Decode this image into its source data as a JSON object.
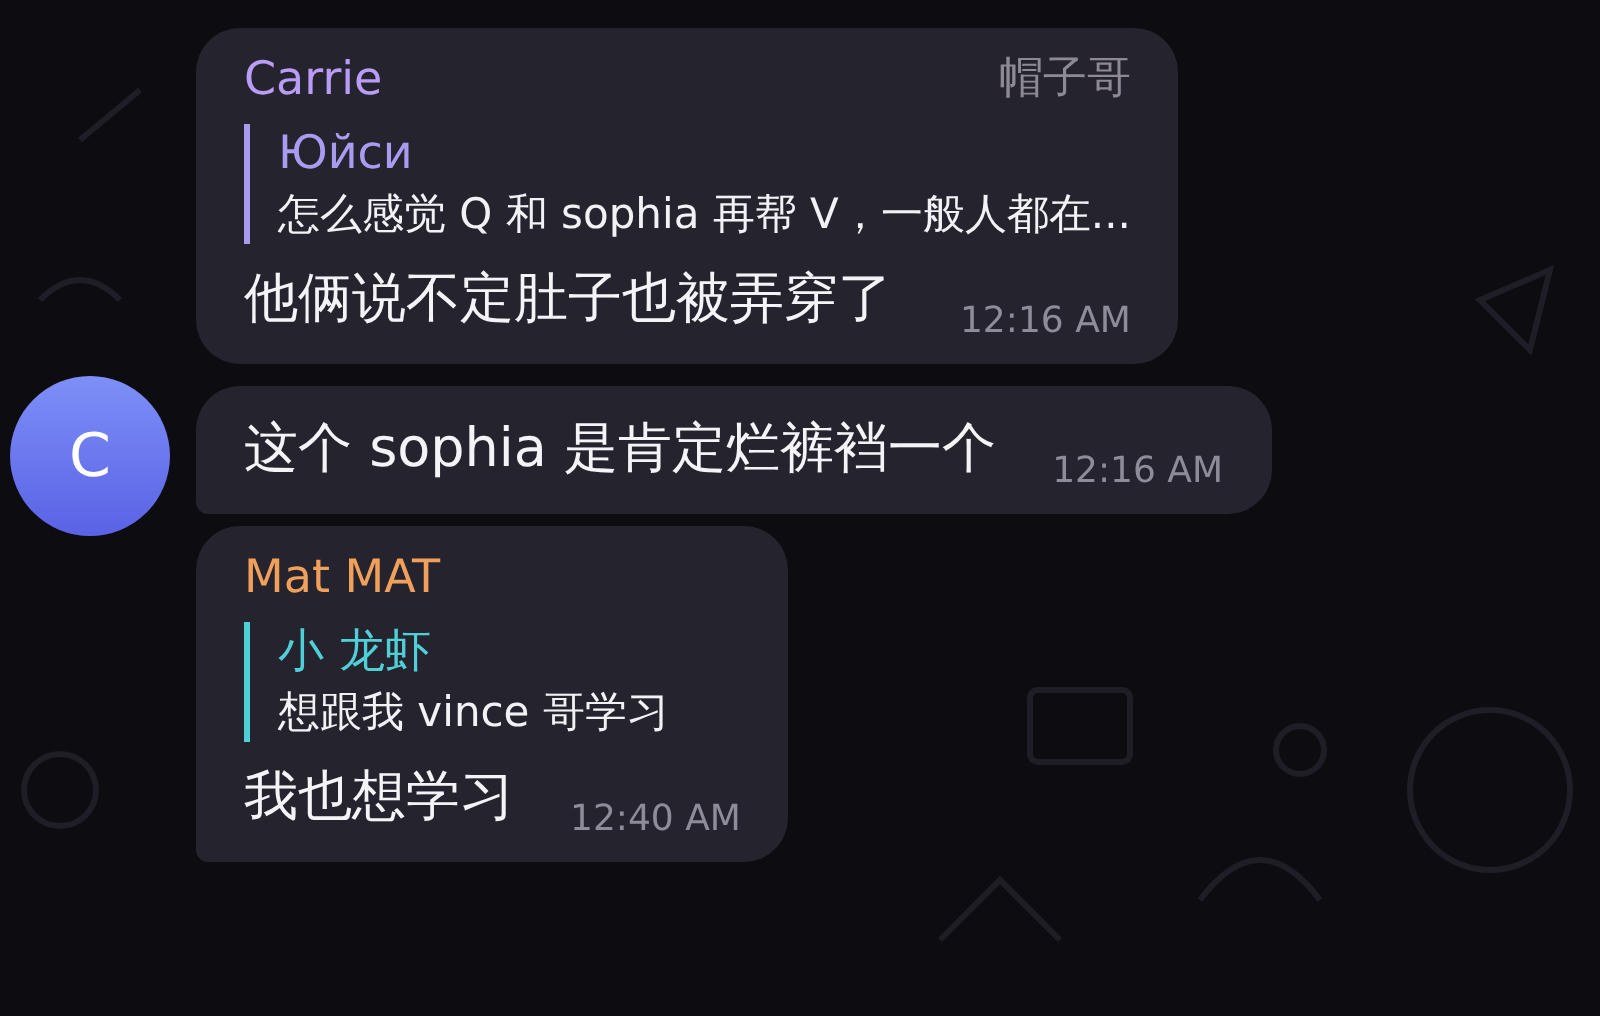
{
  "messages": [
    {
      "sender": "Carrie",
      "color": "#b99cf5",
      "title": "帽子哥",
      "reply": {
        "author": "Юйси",
        "text": "怎么感觉 Q 和 sophia 再帮 V，一般人都在...",
        "color": "#a89cf0"
      },
      "text": "他俩说不定肚子也被弄穿了",
      "time": "12:16 AM"
    },
    {
      "avatar": "C",
      "text": "这个 sophia 是肯定烂裤裆一个",
      "time": "12:16 AM"
    },
    {
      "sender": "Mat MAT",
      "color": "#f0a05a",
      "reply": {
        "author": "小 龙虾",
        "text": "想跟我 vince 哥学习",
        "color": "#4fd0d8"
      },
      "text": "我也想学习",
      "time": "12:40 AM"
    }
  ]
}
